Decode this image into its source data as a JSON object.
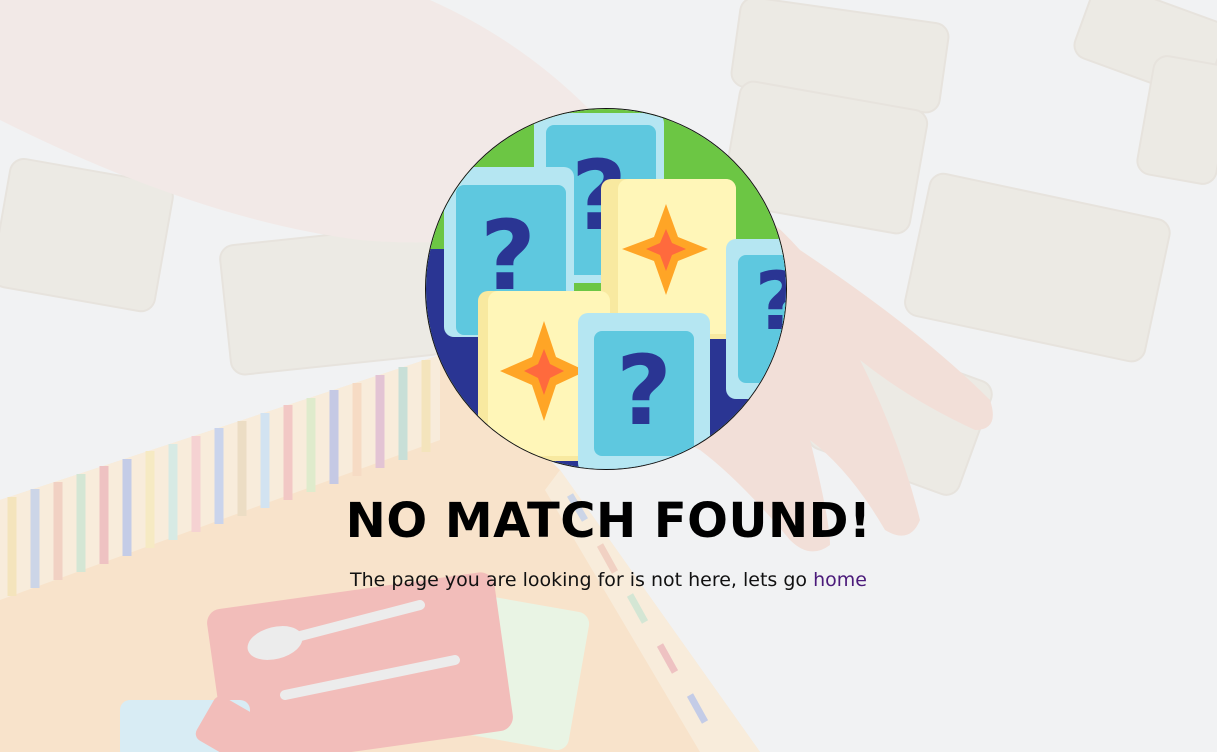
{
  "page": {
    "title": "NO MATCH FOUND!",
    "message_prefix": "The page you are looking for is not here, lets go",
    "home_link_label": "home"
  },
  "icons": {
    "logo": "memory-cards-icon",
    "background": "memory-game-photo"
  },
  "colors": {
    "title": "#000000",
    "link": "#4b1a7a",
    "card_blue": "#5ec8df",
    "card_yellow": "#fff6b8",
    "star_orange": "#ffa526",
    "logo_green": "#6cc644",
    "logo_navy": "#2a3593"
  }
}
